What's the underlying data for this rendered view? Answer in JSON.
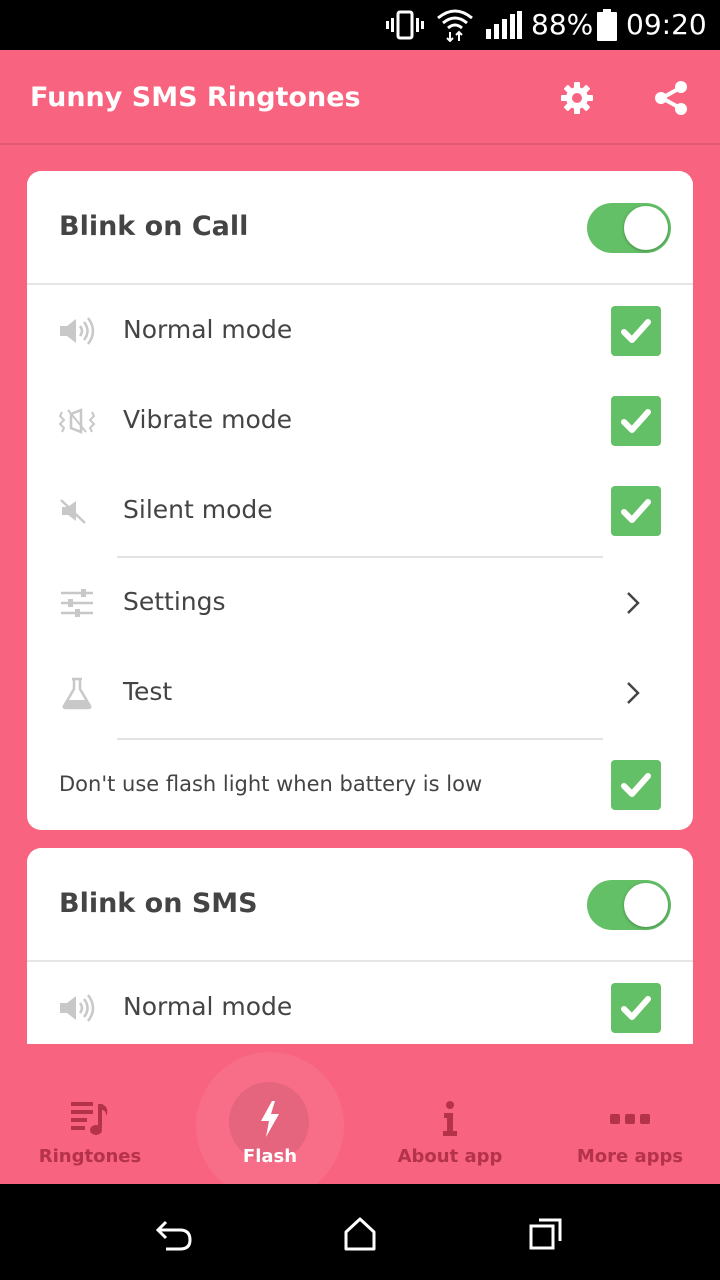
{
  "status_bar": {
    "battery_percent": "88%",
    "time": "09:20",
    "icons": [
      "vibrate-icon",
      "wifi-icon",
      "signal-icon",
      "battery-icon"
    ]
  },
  "app_bar": {
    "title": "Funny SMS Ringtones",
    "actions": [
      "settings-gear-icon",
      "share-icon"
    ]
  },
  "call_card": {
    "title": "Blink on Call",
    "enabled": true,
    "items": [
      {
        "label": "Normal mode",
        "icon": "speaker-icon",
        "checked": true
      },
      {
        "label": "Vibrate mode",
        "icon": "vibrate-mode-icon",
        "checked": true
      },
      {
        "label": "Silent mode",
        "icon": "silent-icon",
        "checked": true
      },
      {
        "label": "Settings",
        "icon": "sliders-icon",
        "type": "link"
      },
      {
        "label": "Test",
        "icon": "flask-icon",
        "type": "link"
      },
      {
        "label": "Don't use flash light when battery is low",
        "checked": true
      }
    ]
  },
  "sms_card": {
    "title": "Blink on SMS",
    "enabled": true,
    "items": [
      {
        "label": "Normal mode",
        "icon": "speaker-icon",
        "checked": true
      }
    ]
  },
  "bottom_nav": {
    "items": [
      {
        "label": "Ringtones",
        "icon": "music-list-icon",
        "active": false
      },
      {
        "label": "Flash",
        "icon": "lightning-icon",
        "active": true
      },
      {
        "label": "About app",
        "icon": "info-icon",
        "active": false
      },
      {
        "label": "More apps",
        "icon": "more-dots-icon",
        "active": false
      }
    ]
  },
  "colors": {
    "primary": "#f8637f",
    "accent_green": "#63c066",
    "nav_inactive": "#b4324a",
    "text_dark": "#444444"
  }
}
